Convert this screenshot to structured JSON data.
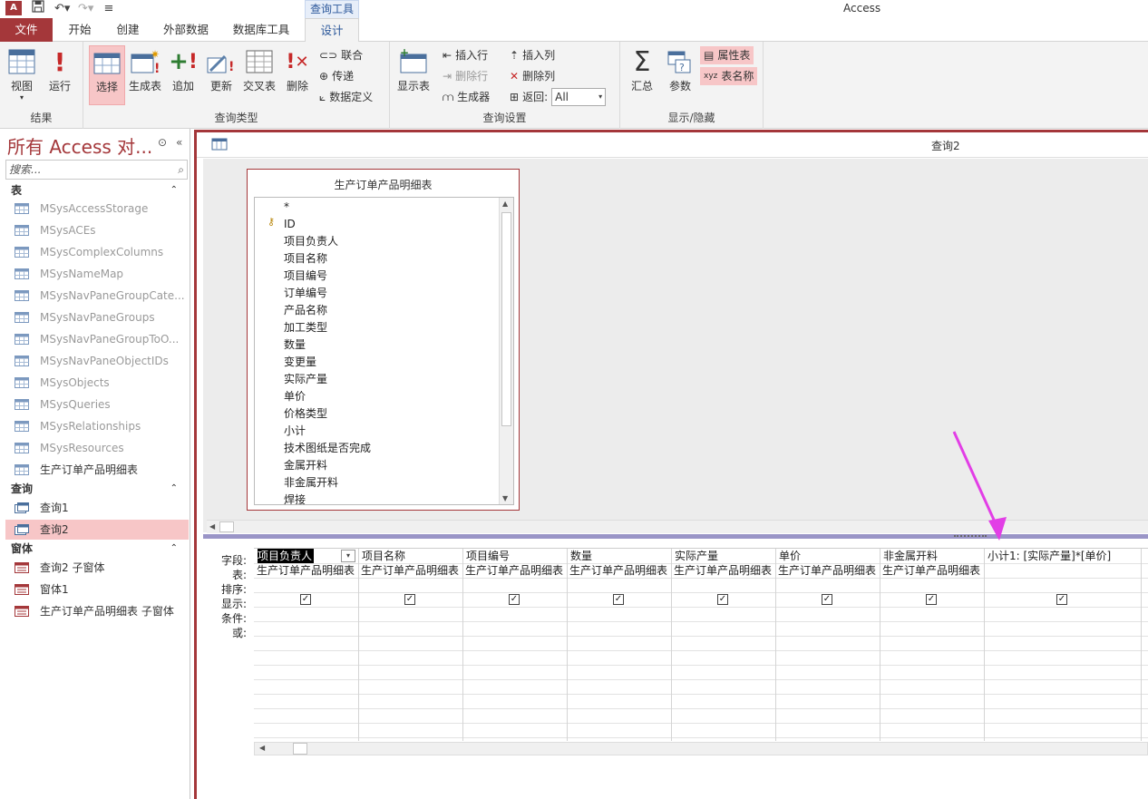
{
  "titlebar": {
    "app_logo": "A",
    "context_tab": "查询工具",
    "app_name": "Access",
    "icons": [
      "access-logo-icon",
      "save-icon",
      "undo-icon",
      "redo-icon",
      "customize-qat-icon"
    ]
  },
  "tabs": {
    "file": "文件",
    "home": "开始",
    "create": "创建",
    "external": "外部数据",
    "dbtools": "数据库工具",
    "design": "设计"
  },
  "ribbon": {
    "results": {
      "label": "结果",
      "view": "视图",
      "run": "运行"
    },
    "query_type": {
      "label": "查询类型",
      "select": "选择",
      "make_table": "生成表",
      "append": "追加",
      "update": "更新",
      "crosstab": "交叉表",
      "delete": "删除",
      "union": "联合",
      "passthrough": "传递",
      "data_def": "数据定义"
    },
    "query_setup": {
      "label": "查询设置",
      "show_table": "显示表",
      "insert_rows": "插入行",
      "delete_rows": "删除行",
      "builder": "生成器",
      "insert_cols": "插入列",
      "delete_cols": "删除列",
      "return_label": "返回:",
      "return_value": "All"
    },
    "show_hide": {
      "label": "显示/隐藏",
      "totals": "汇总",
      "params": "参数",
      "property_sheet": "属性表",
      "table_names": "表名称"
    }
  },
  "nav": {
    "title": "所有 Access 对...",
    "search_placeholder": "搜索...",
    "group_tables": "表",
    "tables": [
      "MSysAccessStorage",
      "MSysACEs",
      "MSysComplexColumns",
      "MSysNameMap",
      "MSysNavPaneGroupCate...",
      "MSysNavPaneGroups",
      "MSysNavPaneGroupToO...",
      "MSysNavPaneObjectIDs",
      "MSysObjects",
      "MSysQueries",
      "MSysRelationships",
      "MSysResources",
      "生产订单产品明细表"
    ],
    "group_queries": "查询",
    "queries": [
      "查询1",
      "查询2"
    ],
    "group_forms": "窗体",
    "forms": [
      "查询2 子窗体",
      "窗体1",
      "生产订单产品明细表 子窗体"
    ]
  },
  "document": {
    "title": "查询2",
    "field_list": {
      "table_name": "生产订单产品明细表",
      "fields": [
        "*",
        "ID",
        "项目负责人",
        "项目名称",
        "项目编号",
        "订单编号",
        "产品名称",
        "加工类型",
        "数量",
        "变更量",
        "实际产量",
        "单价",
        "价格类型",
        "小计",
        "技术图纸是否完成",
        "金属开料",
        "非金属开料",
        "焊接"
      ]
    },
    "grid": {
      "row_labels": [
        "字段:",
        "表:",
        "排序:",
        "显示:",
        "条件:",
        "或:"
      ],
      "columns": [
        {
          "field": "项目负责人",
          "table": "生产订单产品明细表",
          "show": true
        },
        {
          "field": "项目名称",
          "table": "生产订单产品明细表",
          "show": true
        },
        {
          "field": "项目编号",
          "table": "生产订单产品明细表",
          "show": true
        },
        {
          "field": "数量",
          "table": "生产订单产品明细表",
          "show": true
        },
        {
          "field": "实际产量",
          "table": "生产订单产品明细表",
          "show": true
        },
        {
          "field": "单价",
          "table": "生产订单产品明细表",
          "show": true
        },
        {
          "field": "非金属开料",
          "table": "生产订单产品明细表",
          "show": true
        },
        {
          "field": "小计1: [实际产量]*[单价]",
          "table": "",
          "show": true
        }
      ]
    }
  },
  "colors": {
    "accent": "#a4373a",
    "selected_bg": "#f7c6c7",
    "annotation_arrow": "#e23ee6",
    "splitter": "#9a95c7"
  }
}
